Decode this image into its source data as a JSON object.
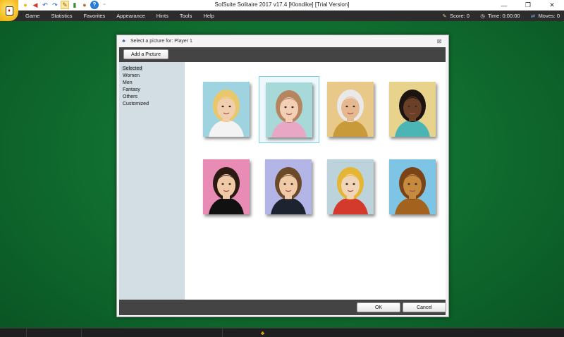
{
  "window": {
    "title": "SolSuite Solitaire 2017 v17.4  [Klondike]  [Trial Version]",
    "minimize_glyph": "—",
    "restore_glyph": "❐",
    "close_glyph": "✕"
  },
  "quick_access": [
    {
      "name": "new-game-icon",
      "glyph": "●",
      "color": "#f2b01e"
    },
    {
      "name": "game-selector-icon",
      "glyph": "◀",
      "color": "#d23a2a"
    },
    {
      "name": "undo-icon",
      "glyph": "↶",
      "color": "#2a62c9"
    },
    {
      "name": "redo-icon",
      "glyph": "↷",
      "color": "#2a62c9"
    },
    {
      "name": "hint-wand-icon",
      "glyph": "✎",
      "color": "#8a6a00"
    },
    {
      "name": "statistics-icon",
      "glyph": "▮",
      "color": "#3a8f3a"
    },
    {
      "name": "appearance-icon",
      "glyph": "●",
      "color": "#b86b2a"
    },
    {
      "name": "help-icon",
      "glyph": "?",
      "color": "#ffffff"
    }
  ],
  "menu": {
    "items": [
      "Game",
      "Statistics",
      "Favorites",
      "Appearance",
      "Hints",
      "Tools",
      "Help"
    ],
    "score": "Score: 0",
    "time": "Time:  0:00:00",
    "moves": "Moves: 0"
  },
  "dialog": {
    "title": "Select a picture for: Player 1",
    "close_glyph": "⊠",
    "add_picture_label": "Add a Picture",
    "categories": [
      "Selected",
      "Women",
      "Men",
      "Fantasy",
      "Others",
      "Customized"
    ],
    "selected_category": "Selected",
    "pictures": [
      {
        "name": "portrait-angel-blonde",
        "bg": "#9fd3e0",
        "skin": "#f1cfae",
        "hair": "#e8c86a",
        "accent": "#f3f3f3",
        "selected": false
      },
      {
        "name": "portrait-woman-flower-hat",
        "bg": "#a7d9d9",
        "skin": "#f2cfb5",
        "hair": "#b58560",
        "accent": "#e8a7c4",
        "selected": true
      },
      {
        "name": "portrait-old-wizard",
        "bg": "#e9c98a",
        "skin": "#e6b890",
        "hair": "#e9e9e9",
        "accent": "#c99a3a",
        "selected": false
      },
      {
        "name": "portrait-woman-dark-curly",
        "bg": "#e8d38c",
        "skin": "#6a4028",
        "hair": "#1b1410",
        "accent": "#4bb5b5",
        "selected": false
      },
      {
        "name": "portrait-businesswoman",
        "bg": "#e88cb6",
        "skin": "#f0c9a6",
        "hair": "#2a1a12",
        "accent": "#111111",
        "selected": false
      },
      {
        "name": "portrait-businessman",
        "bg": "#b3b5e6",
        "skin": "#f0c9a6",
        "hair": "#6b4a2a",
        "accent": "#1e2330",
        "selected": false
      },
      {
        "name": "portrait-jester",
        "bg": "#bcd3dc",
        "skin": "#f1d5b9",
        "hair": "#e4b634",
        "accent": "#d33a2c",
        "selected": false
      },
      {
        "name": "portrait-lion",
        "bg": "#7ec4e4",
        "skin": "#c68a3e",
        "hair": "#7a4418",
        "accent": "#a3631f",
        "selected": false
      }
    ],
    "ok_label": "OK",
    "cancel_label": "Cancel"
  }
}
